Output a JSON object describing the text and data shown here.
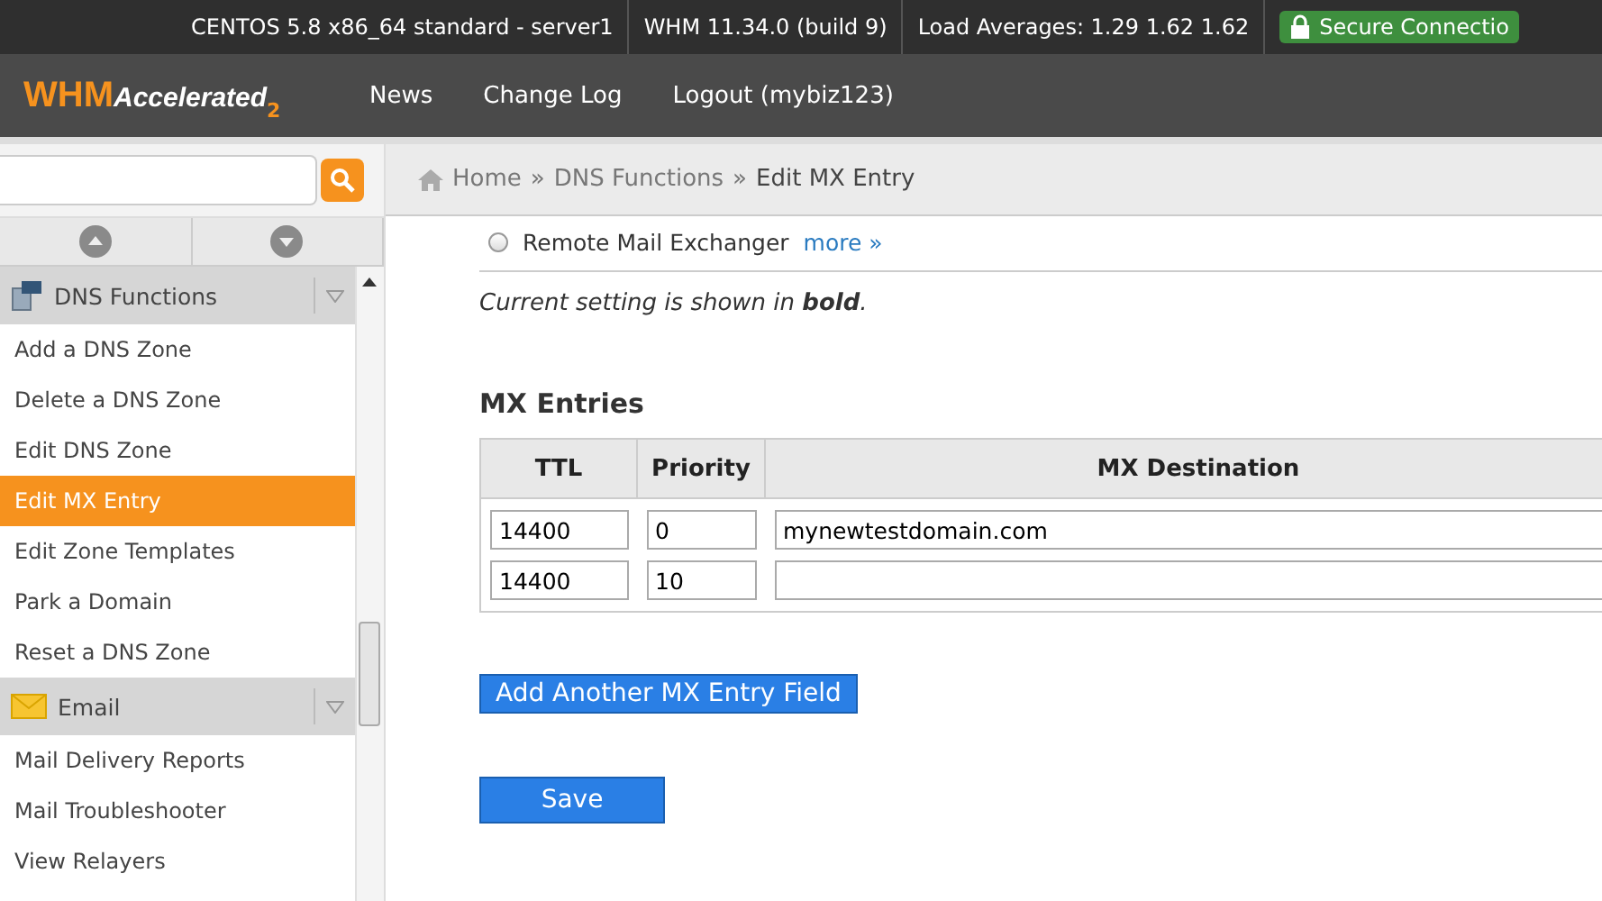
{
  "top_bar": {
    "items": [
      "CENTOS 5.8 x86_64 standard - server1",
      "WHM 11.34.0 (build 9)",
      "Load Averages: 1.29 1.62 1.62"
    ],
    "secure_badge": "Secure Connectio"
  },
  "header": {
    "logo": {
      "main": "WHM",
      "sub": "Accelerated",
      "version": "2"
    },
    "nav": [
      "News",
      "Change Log",
      "Logout (mybiz123)"
    ]
  },
  "sidebar": {
    "groups": [
      {
        "kind": "dns",
        "title": "DNS Functions",
        "items": [
          {
            "label": "Add a DNS Zone",
            "selected": false
          },
          {
            "label": "Delete a DNS Zone",
            "selected": false
          },
          {
            "label": "Edit DNS Zone",
            "selected": false
          },
          {
            "label": "Edit MX Entry",
            "selected": true
          },
          {
            "label": "Edit Zone Templates",
            "selected": false
          },
          {
            "label": "Park a Domain",
            "selected": false
          },
          {
            "label": "Reset a DNS Zone",
            "selected": false
          }
        ]
      },
      {
        "kind": "email",
        "title": "Email",
        "items": [
          {
            "label": "Mail Delivery Reports",
            "selected": false
          },
          {
            "label": "Mail Troubleshooter",
            "selected": false
          },
          {
            "label": "View Relayers",
            "selected": false
          }
        ]
      }
    ]
  },
  "breadcrumb": [
    "Home",
    "DNS Functions",
    "Edit MX Entry"
  ],
  "breadcrumb_separator": "»",
  "radio": {
    "label": "Remote Mail Exchanger",
    "checked": false,
    "link": "more »"
  },
  "note": "Current setting is shown in **bold**.",
  "mx_table": {
    "title": "MX Entries",
    "columns": [
      "TTL",
      "Priority",
      "MX Destination"
    ],
    "rows": [
      {
        "ttl": "14400",
        "priority": "0",
        "destination": "mynewtestdomain.com"
      },
      {
        "ttl": "14400",
        "priority": "10",
        "destination": ""
      }
    ]
  },
  "buttons": {
    "add": "Add Another MX Entry Field",
    "save": "Save"
  }
}
